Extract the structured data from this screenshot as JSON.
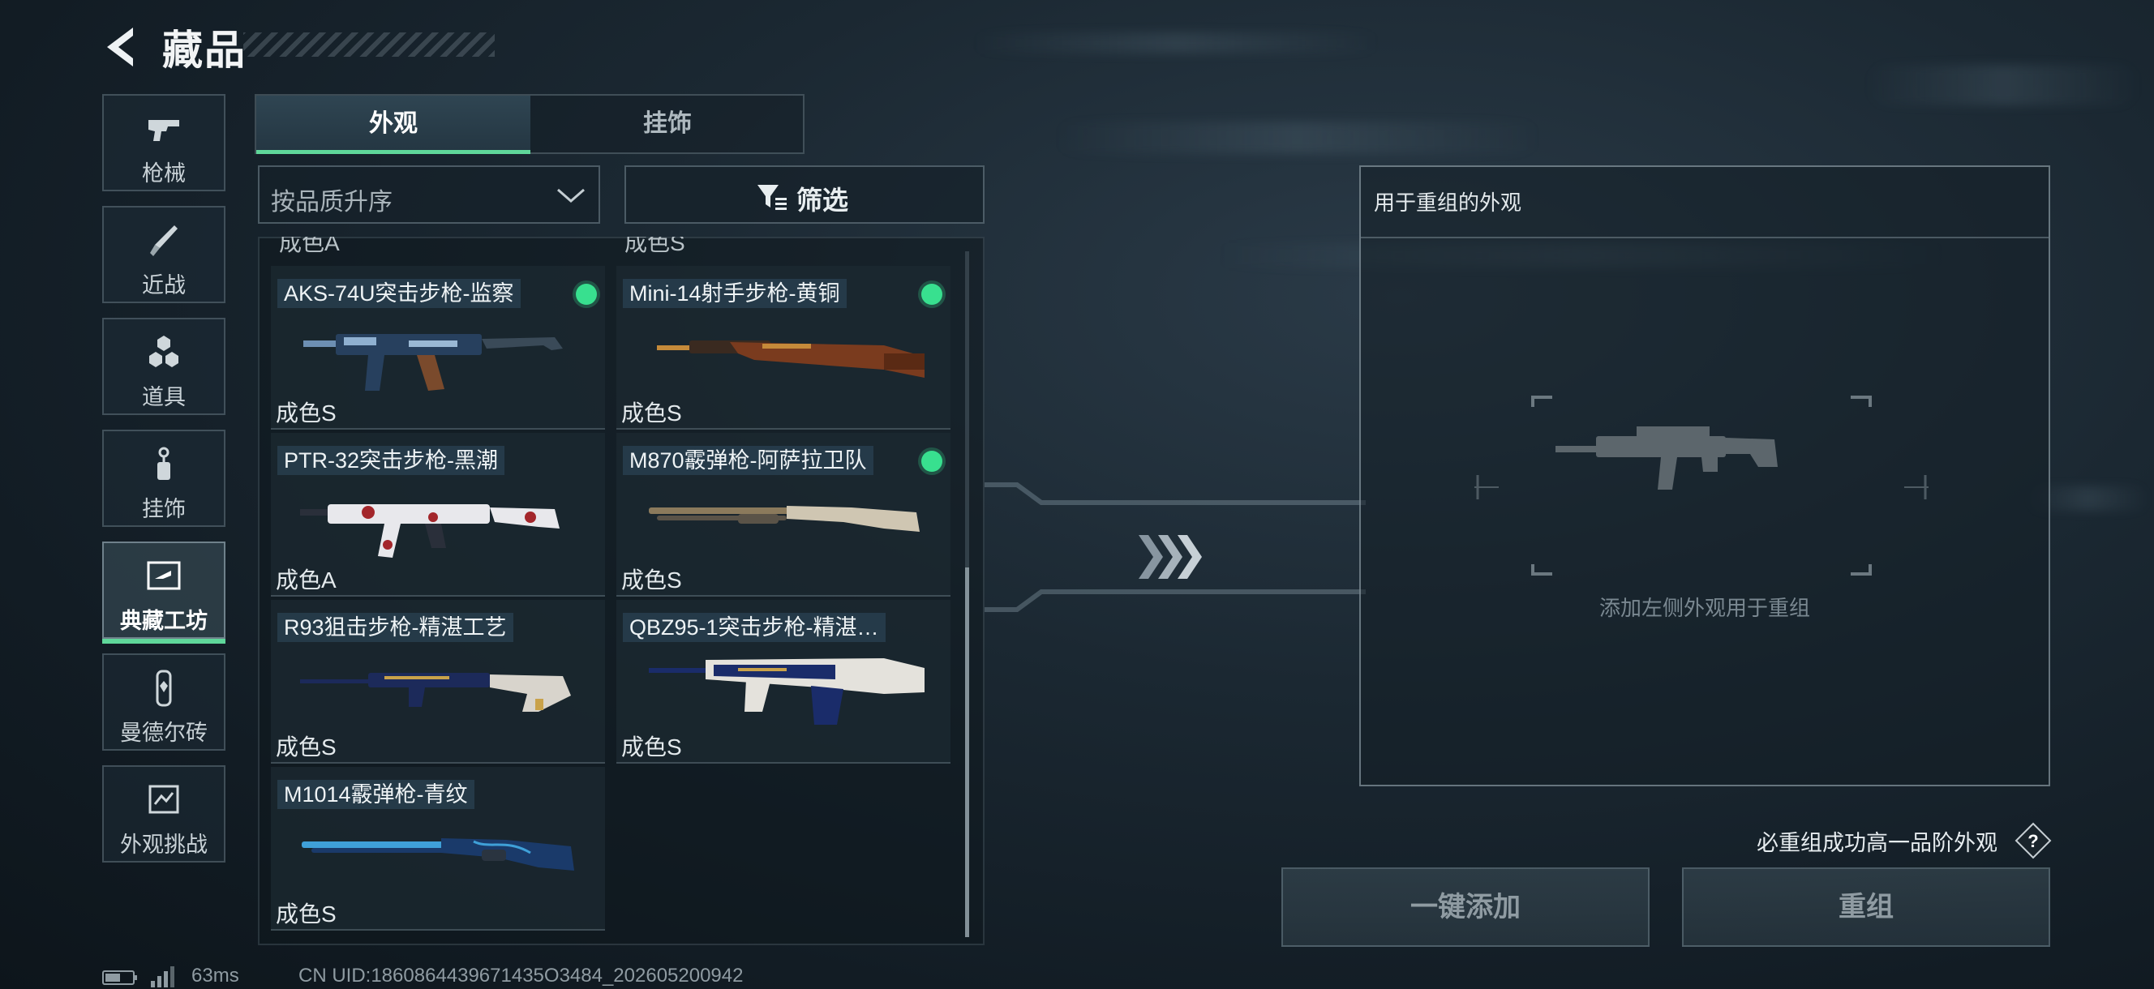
{
  "header": {
    "title": "藏品"
  },
  "nav": [
    {
      "label": "枪械",
      "icon": "pistol-icon"
    },
    {
      "label": "近战",
      "icon": "knife-icon"
    },
    {
      "label": "道具",
      "icon": "grenade-icon"
    },
    {
      "label": "挂饰",
      "icon": "charm-icon"
    },
    {
      "label": "典藏工坊",
      "icon": "workshop-icon",
      "active": true
    },
    {
      "label": "曼德尔砖",
      "icon": "mandel-brick-icon"
    },
    {
      "label": "外观挑战",
      "icon": "challenge-icon"
    }
  ],
  "tabs": [
    {
      "label": "外观",
      "active": true
    },
    {
      "label": "挂饰",
      "active": false
    }
  ],
  "sort": {
    "label": "按品质升序"
  },
  "filter": {
    "label": "筛选"
  },
  "list": {
    "peek_left": "成色A",
    "peek_right": "成色S",
    "items": [
      {
        "name": "AKS-74U突击步枪-监察",
        "grade": "成色S",
        "selected": true,
        "colors": [
          "#27405e",
          "#6d8fb2",
          "#7a4a2c"
        ]
      },
      {
        "name": "Mini-14射手步枪-黄铜",
        "grade": "成色S",
        "selected": true,
        "colors": [
          "#7a3b1e",
          "#c58a3a",
          "#3a2a20"
        ]
      },
      {
        "name": "PTR-32突击步枪-黑潮",
        "grade": "成色A",
        "selected": false,
        "colors": [
          "#e8e8ec",
          "#a3262b",
          "#2a2f3a"
        ]
      },
      {
        "name": "M870霰弹枪-阿萨拉卫队",
        "grade": "成色S",
        "selected": true,
        "colors": [
          "#cfc6b2",
          "#5a5348",
          "#8b7a5c"
        ]
      },
      {
        "name": "R93狙击步枪-精湛工艺",
        "grade": "成色S",
        "selected": false,
        "colors": [
          "#1c2a5a",
          "#d8d4cc",
          "#c9a24a"
        ]
      },
      {
        "name": "QBZ95-1突击步枪-精湛…",
        "grade": "成色S",
        "selected": false,
        "colors": [
          "#1a2c6a",
          "#e4e2dc",
          "#c9a24a"
        ]
      },
      {
        "name": "M1014霰弹枪-青纹",
        "grade": "成色S",
        "selected": false,
        "colors": [
          "#1a3a6a",
          "#3fa0d8",
          "#2a3440"
        ]
      }
    ]
  },
  "recompose": {
    "title": "用于重组的外观",
    "hint": "添加左侧外观用于重组"
  },
  "note": "必重组成功高一品阶外观",
  "buttons": {
    "add_all": "一键添加",
    "recompose": "重组"
  },
  "status": {
    "ping": "63ms",
    "uid": "CN UID:1860864439671435O3484_202605200942"
  },
  "accent_color": "#5fd79a",
  "selected_dot_color": "#38e08f"
}
